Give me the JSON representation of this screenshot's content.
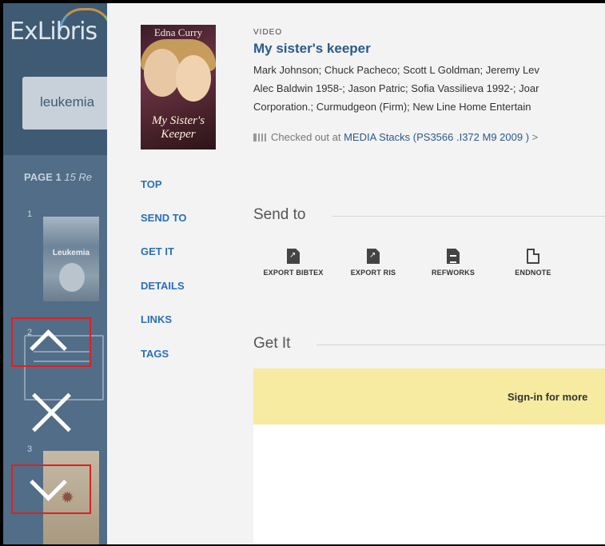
{
  "left_panel": {
    "logo": "ExLibris",
    "search_query": "leukemia",
    "page_label": "PAGE 1",
    "page_results": "15 Re",
    "results": [
      {
        "num": "1",
        "thumb_text": "Leukemia"
      },
      {
        "num": "2"
      },
      {
        "num": "3"
      }
    ]
  },
  "record": {
    "cover_author": "Edna Curry",
    "cover_title": "My Sister's Keeper",
    "type": "VIDEO",
    "title": "My sister's keeper",
    "contributors_line1": "Mark Johnson; Chuck Pacheco; Scott L Goldman; Jeremy Lev",
    "contributors_line2": "Alec Baldwin 1958-; Jason Patric; Sofia Vassilieva 1992-; Joar",
    "contributors_line3": "Corporation.; Curmudgeon (Firm); New Line Home Entertain",
    "availability_status": "Checked out at",
    "availability_location": "MEDIA  Stacks (PS3566 .I372 M9 2009 )",
    "availability_arrow": ">"
  },
  "section_nav": {
    "top": "TOP",
    "send_to": "SEND TO",
    "get_it": "GET IT",
    "details": "DETAILS",
    "links": "LINKS",
    "tags": "TAGS"
  },
  "send_to": {
    "heading": "Send to",
    "actions": [
      {
        "label": "EXPORT BIBTEX",
        "icon": "export-file-icon"
      },
      {
        "label": "EXPORT RIS",
        "icon": "export-file-icon"
      },
      {
        "label": "REFWORKS",
        "icon": "document-lines-icon"
      },
      {
        "label": "ENDNOTE",
        "icon": "document-outline-icon"
      }
    ]
  },
  "get_it": {
    "heading": "Get It",
    "signin_text": "Sign-in for more"
  },
  "colors": {
    "link_blue": "#2a6fb8",
    "title_blue": "#2a5a8a",
    "signin_banner": "#f6eba0",
    "highlight_red": "#e02020"
  }
}
